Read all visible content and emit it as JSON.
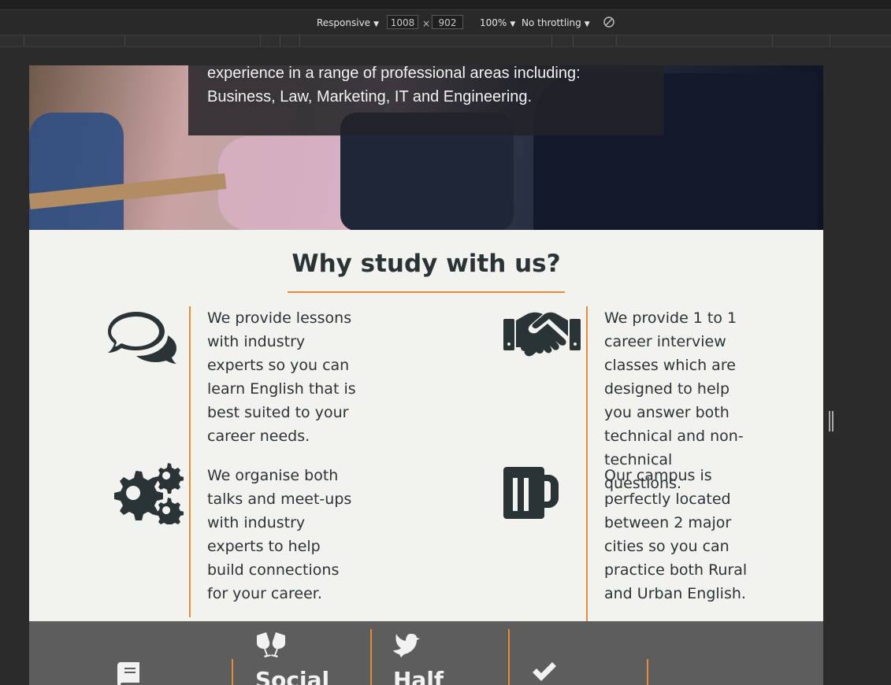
{
  "devtools": {
    "device": "Responsive",
    "width": "1008",
    "times": "×",
    "height": "902",
    "zoom": "100%",
    "throttle": "No throttling"
  },
  "hero": {
    "text_line1": "experience in a range of professional areas including:",
    "text_line2": "Business, Law, Marketing, IT and Engineering."
  },
  "why": {
    "title": "Why study with us?",
    "features": [
      {
        "icon": "comments-icon",
        "text": "We provide lessons with industry experts so you can learn English that is best suited to your career needs."
      },
      {
        "icon": "handshake-icon",
        "text": "We provide 1 to 1 career interview classes which are designed to help you answer both technical and non-technical questions."
      },
      {
        "icon": "gears-icon",
        "text": "We organise both talks and meet-ups with industry experts to help build connections for your career."
      },
      {
        "icon": "beer-mug-icon",
        "text": "Our campus is perfectly located between 2 major cities so you can practice both Rural and Urban English."
      }
    ]
  },
  "benefits": {
    "items": [
      {
        "icon": "book-icon",
        "label": ""
      },
      {
        "icon": "glasses-cheers-icon",
        "label": "Social"
      },
      {
        "icon": "dove-icon",
        "label": "Half"
      },
      {
        "icon": "check-icon",
        "label": ""
      }
    ]
  },
  "colors": {
    "accent": "#e88a3c",
    "text": "#2a3436",
    "section_bg": "#f2f2ee",
    "benefits_bg": "#5d5d5d"
  }
}
